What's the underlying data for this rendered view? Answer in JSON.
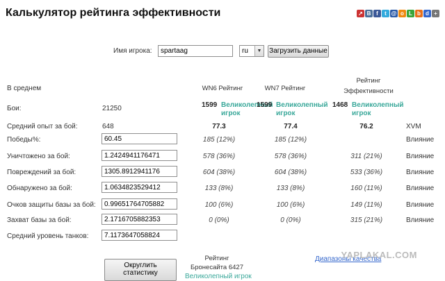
{
  "title": "Калькулятор рейтинга эффективности",
  "share_icons": [
    {
      "name": "share-icon",
      "char": "↗",
      "color": "#cc3333"
    },
    {
      "name": "vkontakte-icon",
      "char": "В",
      "color": "#4a6f9b"
    },
    {
      "name": "facebook-icon",
      "char": "f",
      "color": "#3b5998"
    },
    {
      "name": "twitter-icon",
      "char": "t",
      "color": "#33aadd"
    },
    {
      "name": "mail-icon",
      "char": "@",
      "color": "#2a5aa8"
    },
    {
      "name": "odnoklassniki-icon",
      "char": "o",
      "color": "#f08a10"
    },
    {
      "name": "liveinternet-icon",
      "char": "L",
      "color": "#3aa53a"
    },
    {
      "name": "blogger-icon",
      "char": "b",
      "color": "#e8701a"
    },
    {
      "name": "delicious-icon",
      "char": "d",
      "color": "#3366cc"
    },
    {
      "name": "more-icon",
      "char": "+",
      "color": "#777777"
    }
  ],
  "player": {
    "label": "Имя игрока:",
    "value": "spartaag",
    "server": "ru",
    "load_button": "Загрузить данные"
  },
  "headers": {
    "average": "В среднем",
    "wn6": "WN6 Рейтинг",
    "wn7": "WN7 Рейтинг",
    "eff_line1": "Рейтинг",
    "eff_line2": "Эффективности"
  },
  "battles": {
    "label": "Бои:",
    "value": "21250",
    "wn6": {
      "score": "1599",
      "grade_line1": "Великолепный",
      "grade_line2": "игрок"
    },
    "wn7": {
      "score": "1599",
      "grade_line1": "Великолепный",
      "grade_line2": "игрок"
    },
    "eff": {
      "score": "1468",
      "grade_line1": "Великолепный",
      "grade_line2": "игрок"
    }
  },
  "avg_xp": {
    "label": "Средний опыт за бой:",
    "value": "648",
    "wn6": "77.3",
    "wn7": "77.4",
    "eff": "76.2",
    "extra": "XVM"
  },
  "rows": [
    {
      "label": "Победы%:",
      "value": "60.45",
      "wn6": "185 (12%)",
      "wn7": "185 (12%)",
      "eff": "",
      "infl": "Влияние"
    },
    {
      "label": "Уничтожено за бой:",
      "value": "1.2424941176471",
      "wn6": "578 (36%)",
      "wn7": "578 (36%)",
      "eff": "311 (21%)",
      "infl": "Влияние"
    },
    {
      "label": "Повреждений за бой:",
      "value": "1305.8912941176",
      "wn6": "604 (38%)",
      "wn7": "604 (38%)",
      "eff": "533 (36%)",
      "infl": "Влияние"
    },
    {
      "label": "Обнаружено за бой:",
      "value": "1.0634823529412",
      "wn6": "133 (8%)",
      "wn7": "133 (8%)",
      "eff": "160 (11%)",
      "infl": "Влияние"
    },
    {
      "label": "Очков защиты базы за бой:",
      "value": "0.99651764705882",
      "wn6": "100 (6%)",
      "wn7": "100 (6%)",
      "eff": "149 (11%)",
      "infl": "Влияние"
    },
    {
      "label": "Захват базы за бой:",
      "value": "2.1716705882353",
      "wn6": "0 (0%)",
      "wn7": "0 (0%)",
      "eff": "315 (21%)",
      "infl": "Влияние"
    },
    {
      "label": "Средний уровень танков:",
      "value": "7.1173647058824",
      "wn6": "",
      "wn7": "",
      "eff": "",
      "infl": ""
    }
  ],
  "bottom": {
    "round_button_line1": "Округлить",
    "round_button_line2": "статистику",
    "armor_line1": "Рейтинг",
    "armor_line2": "Бронесайта 6427",
    "armor_grade": "Великолепный игрок",
    "ranges_link": "Диапазоны качества"
  },
  "watermark": "YAPLAKAL.COM"
}
